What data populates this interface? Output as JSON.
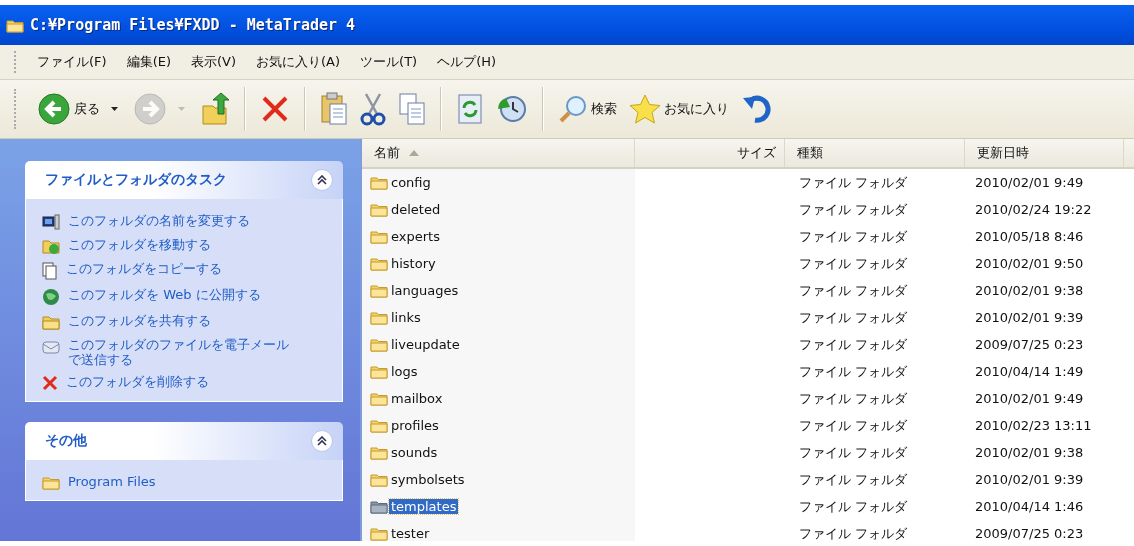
{
  "window": {
    "title": "C:¥Program Files¥FXDD - MetaTrader 4"
  },
  "menu": [
    "ファイル(F)",
    "編集(E)",
    "表示(V)",
    "お気に入り(A)",
    "ツール(T)",
    "ヘルプ(H)"
  ],
  "toolbar": [
    {
      "kind": "button",
      "label": "戻る",
      "dropdown": true,
      "disabled": false
    },
    {
      "kind": "button",
      "dropdown": true,
      "disabled": true
    },
    {
      "kind": "button",
      "dropdown": false,
      "disabled": false
    },
    {
      "kind": "separator"
    },
    {
      "kind": "button",
      "dropdown": false,
      "disabled": false
    },
    {
      "kind": "separator"
    },
    {
      "kind": "button",
      "dropdown": false,
      "disabled": false
    },
    {
      "kind": "button",
      "dropdown": false,
      "disabled": false
    },
    {
      "kind": "button",
      "dropdown": false,
      "disabled": false
    },
    {
      "kind": "separator"
    },
    {
      "kind": "button",
      "dropdown": false,
      "disabled": false
    },
    {
      "kind": "button",
      "dropdown": false,
      "disabled": false
    },
    {
      "kind": "separator"
    },
    {
      "kind": "button",
      "label": "検索",
      "dropdown": false,
      "disabled": false
    },
    {
      "kind": "button",
      "label": "お気に入り",
      "dropdown": false,
      "disabled": false
    },
    {
      "kind": "button",
      "dropdown": false,
      "disabled": false
    }
  ],
  "sidebar": {
    "panels": [
      {
        "title": "ファイルとフォルダのタスク",
        "expanded": true,
        "items": [
          {
            "label": "このフォルダの名前を変更する"
          },
          {
            "label": "このフォルダを移動する"
          },
          {
            "label": "このフォルダをコピーする"
          },
          {
            "label": "このフォルダを Web に公開する"
          },
          {
            "label": "このフォルダを共有する"
          },
          {
            "label": "このフォルダのファイルを電子メールで送信する"
          },
          {
            "label": "このフォルダを削除する"
          }
        ]
      },
      {
        "title": "その他",
        "expanded": true,
        "items": [
          {
            "label": "Program Files"
          }
        ]
      }
    ]
  },
  "file_list": {
    "columns": [
      {
        "label": "名前",
        "sorted": true
      },
      {
        "label": "サイズ",
        "sorted": false
      },
      {
        "label": "種類",
        "sorted": false
      },
      {
        "label": "更新日時",
        "sorted": false
      }
    ],
    "rows": [
      {
        "name": "config",
        "type": "ファイル フォルダ",
        "modified": "2010/02/01 9:49",
        "selected": false
      },
      {
        "name": "deleted",
        "type": "ファイル フォルダ",
        "modified": "2010/02/24 19:22",
        "selected": false
      },
      {
        "name": "experts",
        "type": "ファイル フォルダ",
        "modified": "2010/05/18 8:46",
        "selected": false
      },
      {
        "name": "history",
        "type": "ファイル フォルダ",
        "modified": "2010/02/01 9:50",
        "selected": false
      },
      {
        "name": "languages",
        "type": "ファイル フォルダ",
        "modified": "2010/02/01 9:38",
        "selected": false
      },
      {
        "name": "links",
        "type": "ファイル フォルダ",
        "modified": "2010/02/01 9:39",
        "selected": false
      },
      {
        "name": "liveupdate",
        "type": "ファイル フォルダ",
        "modified": "2009/07/25 0:23",
        "selected": false
      },
      {
        "name": "logs",
        "type": "ファイル フォルダ",
        "modified": "2010/04/14 1:49",
        "selected": false
      },
      {
        "name": "mailbox",
        "type": "ファイル フォルダ",
        "modified": "2010/02/01 9:49",
        "selected": false
      },
      {
        "name": "profiles",
        "type": "ファイル フォルダ",
        "modified": "2010/02/23 13:11",
        "selected": false
      },
      {
        "name": "sounds",
        "type": "ファイル フォルダ",
        "modified": "2010/02/01 9:38",
        "selected": false
      },
      {
        "name": "symbolsets",
        "type": "ファイル フォルダ",
        "modified": "2010/02/01 9:39",
        "selected": false
      },
      {
        "name": "templates",
        "type": "ファイル フォルダ",
        "modified": "2010/04/14 1:46",
        "selected": true
      },
      {
        "name": "tester",
        "type": "ファイル フォルダ",
        "modified": "2009/07/25 0:23",
        "selected": false
      }
    ]
  }
}
